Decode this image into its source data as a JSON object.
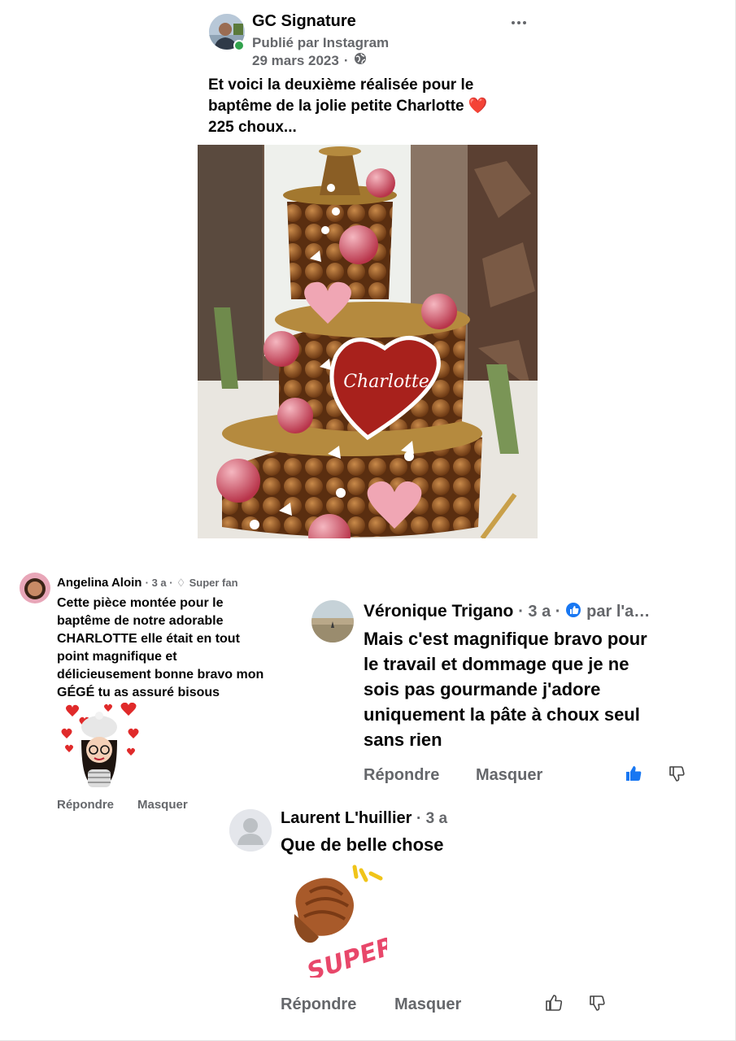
{
  "post": {
    "author": "GC Signature",
    "published_via": "Publié par Instagram",
    "date": "29 mars 2023",
    "separator": "·",
    "text_line1": "Et voici la deuxième réalisée pour le",
    "text_line2": "baptême de la jolie petite Charlotte ❤️",
    "text_line3": "225 choux...",
    "image_caption": "Charlotte"
  },
  "comments": [
    {
      "author": "Angelina Aloin",
      "time": "· 3 a ·",
      "badge": "Super fan",
      "text_lines": [
        "Cette pièce montée pour le",
        "baptême de notre adorable",
        "CHARLOTTE  elle était en tout",
        "point magnifique et",
        "délicieusement bonne bravo mon",
        "GÉGÉ  tu as assuré bisous"
      ],
      "reply": "Répondre",
      "hide": "Masquer"
    },
    {
      "author": "Véronique Trigano",
      "time": "· 3 a ·",
      "badge": "par l'a…",
      "text_lines": [
        "Mais c'est magnifique bravo pour",
        "le travail et dommage que je ne",
        "sois pas gourmande j'adore",
        "uniquement la pâte à choux seul",
        "sans rien"
      ],
      "reply": "Répondre",
      "hide": "Masquer"
    },
    {
      "author": "Laurent L'huillier",
      "time": "· 3 a",
      "text": "Que de belle chose",
      "sticker_text": "SUPER!",
      "reply": "Répondre",
      "hide": "Masquer"
    }
  ],
  "icons": {
    "more": "more-icon",
    "globe": "globe-icon",
    "like": "thumbs-up-icon",
    "dislike": "thumbs-down-icon",
    "badge": "diamond-icon",
    "verified": "verified-icon"
  },
  "colors": {
    "text": "#050505",
    "secondary": "#65676b",
    "online": "#31a24c",
    "like_active": "#1877f2"
  }
}
